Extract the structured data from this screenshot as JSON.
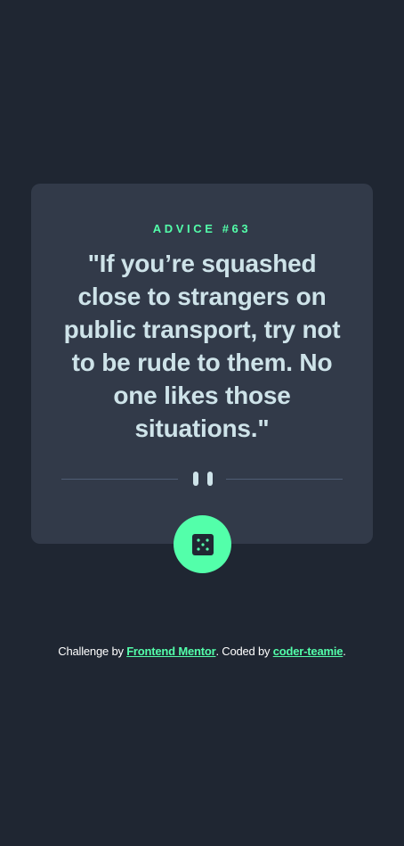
{
  "card": {
    "advice_label": "ADVICE #63",
    "quote": "\"If you’re squashed close to strangers on public transport, try not to be rude to them. No one likes those situations.\""
  },
  "divider": {
    "icon": "pause-icon"
  },
  "dice_button": {
    "icon": "dice-icon"
  },
  "footer": {
    "prefix": "Challenge by ",
    "link1": "Frontend Mentor",
    "middle": ". Coded by ",
    "link2": "coder-teamie",
    "suffix": "."
  },
  "colors": {
    "background": "#1f2632",
    "card": "#323a49",
    "accent": "#53ffaa",
    "quote_text": "#cee3e9",
    "divider": "#4f5d74"
  }
}
